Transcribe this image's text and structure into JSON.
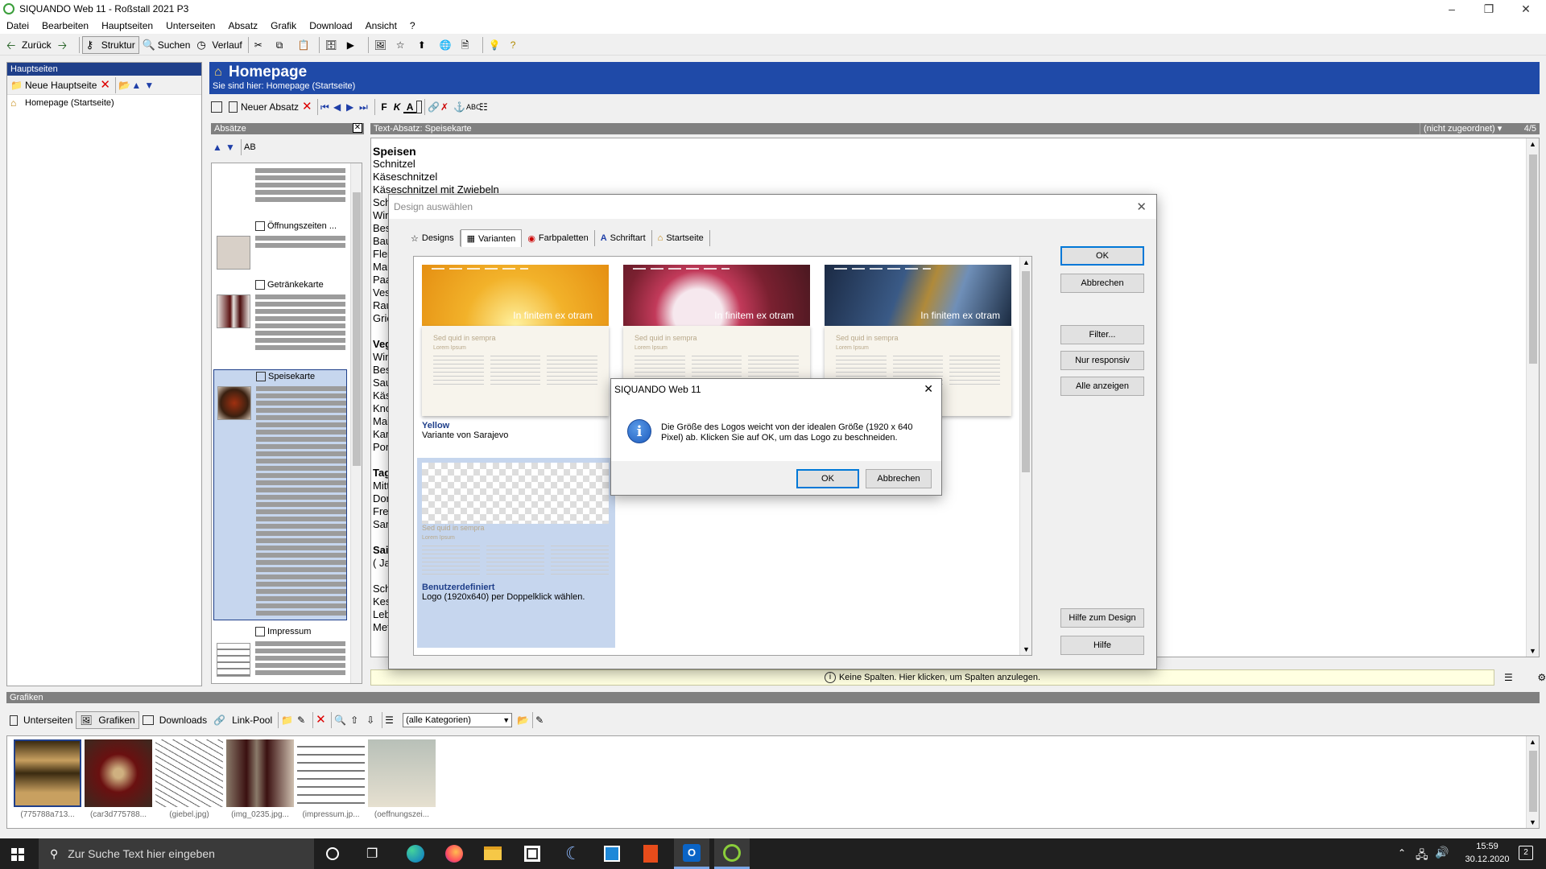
{
  "window": {
    "title": "SIQUANDO Web 11 - Roßstall 2021 P3"
  },
  "menu": [
    "Datei",
    "Bearbeiten",
    "Hauptseiten",
    "Unterseiten",
    "Absatz",
    "Grafik",
    "Download",
    "Ansicht",
    "?"
  ],
  "toolbar": {
    "back": "Zurück",
    "structure": "Struktur",
    "search": "Suchen",
    "history": "Verlauf"
  },
  "left": {
    "header": "Hauptseiten",
    "new_page": "Neue Hauptseite",
    "tree_item": "Homepage (Startseite)"
  },
  "page": {
    "title": "Homepage",
    "breadcrumb": "Sie sind hier: Homepage (Startseite)"
  },
  "para_toolbar": {
    "new_para": "Neuer Absatz",
    "bold": "F",
    "italic": "K"
  },
  "absaetze": {
    "header": "Absätze",
    "sort_label": "AB",
    "items": [
      "Öffnungszeiten ...",
      "Getränkekarte",
      "Speisekarte",
      "Impressum"
    ]
  },
  "editor": {
    "header": "Text-Absatz: Speisekarte",
    "assign": "(nicht zugeordnet)",
    "page_count": "4/5",
    "lines": [
      "Speisen",
      "Schnitzel",
      "Käseschnitzel",
      "Käseschnitzel mit Zwiebeln"
    ],
    "left_fragments": [
      "Sch",
      "Win",
      "Bes",
      "Bau",
      "Flei",
      "Mau",
      "Paa",
      "Ves",
      "Rau",
      "Grie",
      "",
      "Veg",
      "Win",
      "Bes",
      "Sau",
      "Käs",
      "Kno",
      "Mai",
      "Kart",
      "Port",
      "",
      "Tag",
      "Mitt",
      "Dor",
      "Frei",
      "San",
      "",
      "Sai",
      "( Ja",
      "",
      "Sch",
      "Kes",
      "Leb",
      "Met"
    ],
    "status": "Keine Spalten. Hier klicken, um Spalten anzulegen."
  },
  "design_dialog": {
    "title": "Design auswählen",
    "tabs": [
      "Designs",
      "Varianten",
      "Farbpaletten",
      "Schriftart",
      "Startseite"
    ],
    "buttons": [
      "OK",
      "Abbrechen",
      "Filter...",
      "Nur responsiv",
      "Alle anzeigen",
      "Hilfe zum Design",
      "Hilfe"
    ],
    "cards": [
      {
        "name": "Yellow",
        "desc": "Variante von Sarajevo",
        "hero_text": "In finitem ex otram"
      },
      {
        "name": "",
        "desc": "",
        "hero_text": "In finitem ex otram"
      },
      {
        "name": "",
        "desc": "",
        "hero_text": "In finitem ex otram"
      },
      {
        "name": "Benutzerdefiniert",
        "desc": "Logo (1920x640) per Doppelklick wählen.",
        "hero_text": ""
      }
    ],
    "sample_heading": "Sed quid in sempra",
    "sample_sub": "Lorem Ipsum"
  },
  "msgbox": {
    "title": "SIQUANDO Web 11",
    "text": "Die Größe des Logos weicht von der idealen Größe (1920 x 640 Pixel) ab. Klicken Sie auf OK, um das Logo zu beschneiden.",
    "ok": "OK",
    "cancel": "Abbrechen"
  },
  "grafiken": {
    "header": "Grafiken",
    "tabs": [
      "Unterseiten",
      "Grafiken",
      "Downloads",
      "Link-Pool"
    ],
    "category": "(alle Kategorien)",
    "thumbs": [
      "(775788a713...",
      "(car3d775788...",
      "(giebel.jpg)",
      "(img_0235.jpg...",
      "(impressum.jp...",
      "(oeffnungszei..."
    ]
  },
  "taskbar": {
    "search_placeholder": "Zur Suche Text hier eingeben",
    "time": "15:59",
    "date": "30.12.2020",
    "notif_count": "2"
  }
}
